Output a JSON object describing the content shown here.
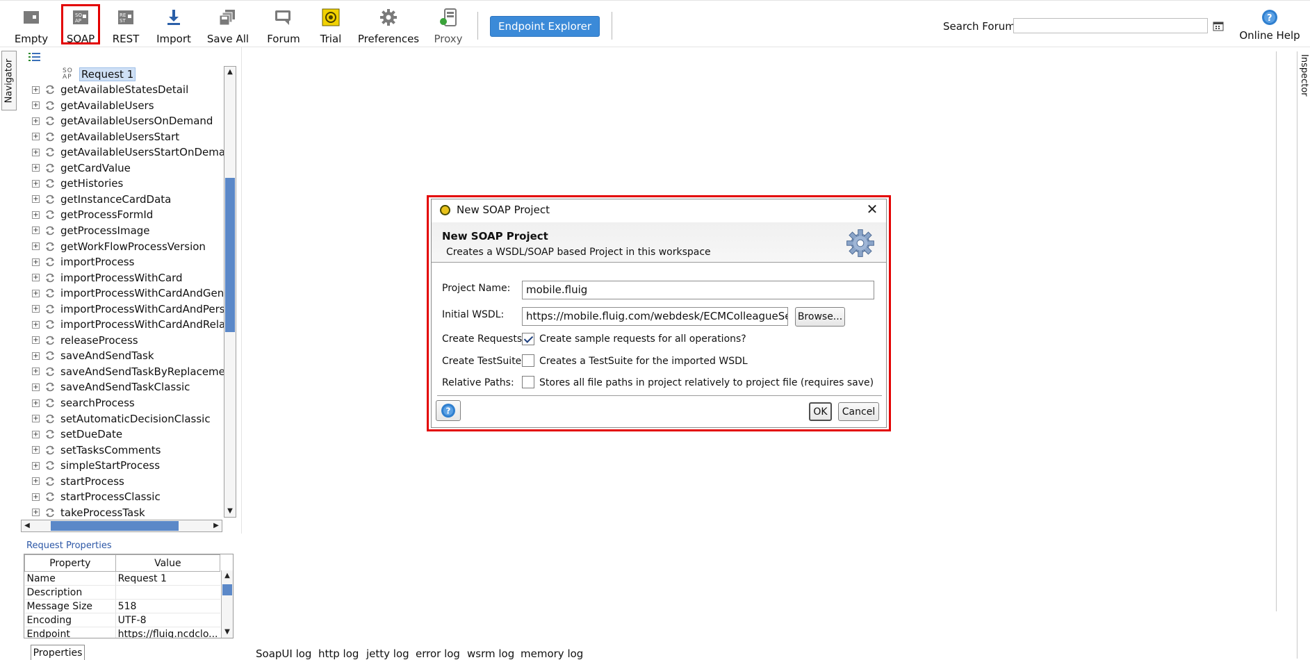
{
  "toolbar": {
    "buttons": [
      {
        "label": "Empty",
        "icon": "empty-project-icon"
      },
      {
        "label": "SOAP",
        "icon": "soap-project-icon"
      },
      {
        "label": "REST",
        "icon": "rest-project-icon"
      },
      {
        "label": "Import",
        "icon": "import-icon"
      },
      {
        "label": "Save All",
        "icon": "save-all-icon"
      },
      {
        "label": "Forum",
        "icon": "forum-icon"
      },
      {
        "label": "Trial",
        "icon": "trial-icon"
      },
      {
        "label": "Preferences",
        "icon": "gear-icon"
      },
      {
        "label": "Proxy",
        "icon": "proxy-icon"
      }
    ],
    "endpoint_explorer": "Endpoint Explorer",
    "search_label": "Search Forum",
    "search_value": "",
    "online_help": "Online Help"
  },
  "navigator": {
    "tab_label": "Navigator",
    "selected_request": "Request 1",
    "selected_request_icon_text": "SO AP",
    "operations": [
      "getAvailableStatesDetail",
      "getAvailableUsers",
      "getAvailableUsersOnDemand",
      "getAvailableUsersStart",
      "getAvailableUsersStartOnDemand",
      "getCardValue",
      "getHistories",
      "getInstanceCardData",
      "getProcessFormId",
      "getProcessImage",
      "getWorkFlowProcessVersion",
      "importProcess",
      "importProcessWithCard",
      "importProcessWithCardAndGenera",
      "importProcessWithCardAndPersiste",
      "importProcessWithCardAndRelated",
      "releaseProcess",
      "saveAndSendTask",
      "saveAndSendTaskByReplacement",
      "saveAndSendTaskClassic",
      "searchProcess",
      "setAutomaticDecisionClassic",
      "setDueDate",
      "setTasksComments",
      "simpleStartProcess",
      "startProcess",
      "startProcessClassic",
      "takeProcessTask"
    ]
  },
  "request_properties": {
    "title": "Request Properties",
    "col_property": "Property",
    "col_value": "Value",
    "rows": [
      {
        "name": "Name",
        "value": "Request 1"
      },
      {
        "name": "Description",
        "value": ""
      },
      {
        "name": "Message Size",
        "value": "518"
      },
      {
        "name": "Encoding",
        "value": "UTF-8"
      },
      {
        "name": "Endpoint",
        "value": "https://fluig.ncdclo..."
      }
    ],
    "tab_label": "Properties"
  },
  "logs": [
    "SoapUI log",
    "http log",
    "jetty log",
    "error log",
    "wsrm log",
    "memory log"
  ],
  "inspector": {
    "tab_label": "Inspector"
  },
  "dialog": {
    "window_title": "New SOAP Project",
    "header_title": "New SOAP Project",
    "header_desc": "Creates a WSDL/SOAP based Project in this workspace",
    "project_name_label": "Project Name:",
    "project_name_value": "mobile.fluig",
    "initial_wsdl_label": "Initial WSDL:",
    "initial_wsdl_value": "https://mobile.fluig.com/webdesk/ECMColleagueService",
    "browse_label": "Browse...",
    "create_requests_label": "Create Requests:",
    "create_requests_text": "Create sample requests for all operations?",
    "create_requests_checked": true,
    "create_testsuite_label": "Create TestSuite:",
    "create_testsuite_text": "Creates a TestSuite for the imported WSDL",
    "create_testsuite_checked": false,
    "relative_paths_label": "Relative Paths:",
    "relative_paths_text": "Stores all file paths in project relatively to project file (requires save)",
    "relative_paths_checked": false,
    "ok_label": "OK",
    "cancel_label": "Cancel"
  },
  "colors": {
    "accent": "#3b8ad8",
    "highlight": "#e30000",
    "selection": "#cfe0f5",
    "scroll_thumb": "#5b88c8"
  }
}
